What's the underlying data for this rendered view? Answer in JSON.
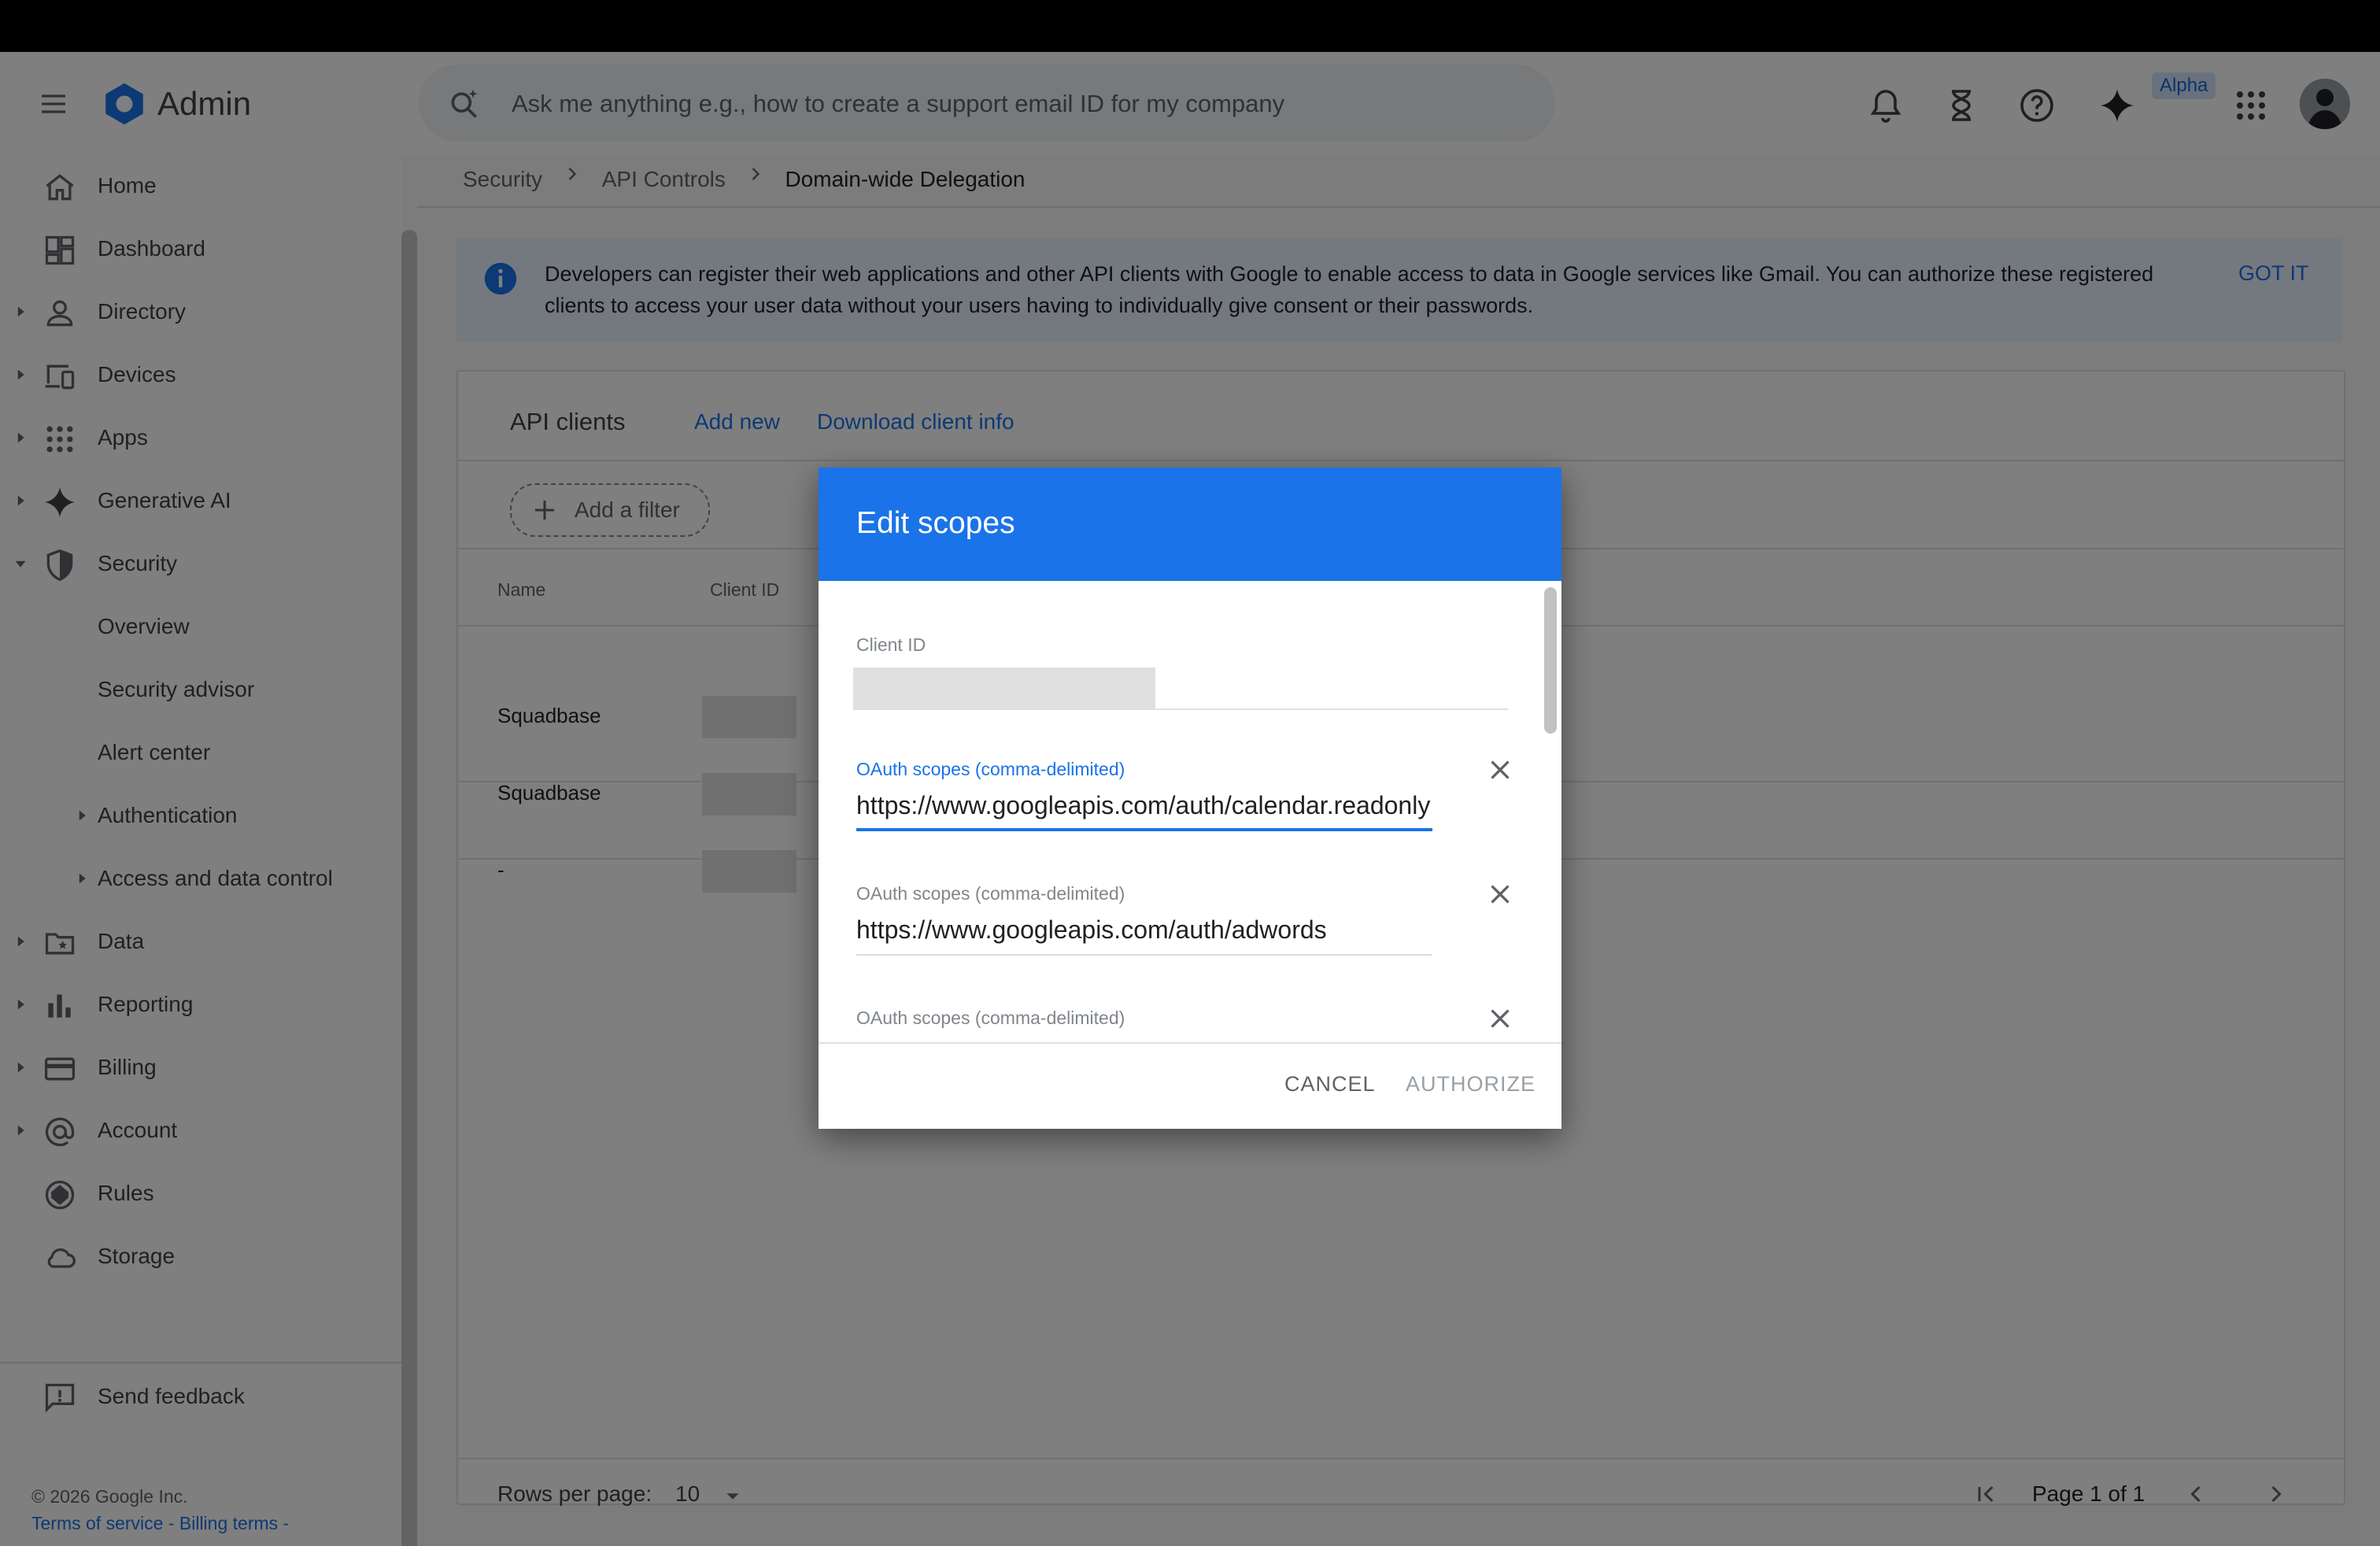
{
  "app": {
    "brand": "Admin",
    "search_placeholder": "Ask me anything e.g., how to create a support email ID for my company",
    "alpha_badge": "Alpha"
  },
  "sidebar": {
    "items": [
      {
        "label": "Home"
      },
      {
        "label": "Dashboard"
      },
      {
        "label": "Directory"
      },
      {
        "label": "Devices"
      },
      {
        "label": "Apps"
      },
      {
        "label": "Generative AI"
      },
      {
        "label": "Security"
      },
      {
        "label": "Overview"
      },
      {
        "label": "Security advisor"
      },
      {
        "label": "Alert center"
      },
      {
        "label": "Authentication"
      },
      {
        "label": "Access and data control"
      },
      {
        "label": "Data"
      },
      {
        "label": "Reporting"
      },
      {
        "label": "Billing"
      },
      {
        "label": "Account"
      },
      {
        "label": "Rules"
      },
      {
        "label": "Storage"
      }
    ],
    "feedback": "Send feedback",
    "copyright": "© 2026 Google Inc.",
    "terms": "Terms of service",
    "billing_terms": "Billing terms",
    "link_sep": " - "
  },
  "breadcrumb": {
    "items": [
      "Security",
      "API Controls"
    ],
    "current": "Domain-wide Delegation"
  },
  "banner": {
    "text": "Developers can register their web applications and other API clients with Google to enable access to data in Google services like Gmail. You can authorize these registered clients to access your user data without your users having to individually give consent or their passwords.",
    "action": "GOT IT"
  },
  "api_clients": {
    "title": "API clients",
    "add_new": "Add new",
    "download": "Download client info",
    "filter": "Add a filter",
    "columns": [
      "Name",
      "Client ID"
    ],
    "rows": [
      {
        "name": "Squadbase"
      },
      {
        "name": "Squadbase"
      },
      {
        "name": "-"
      }
    ],
    "rows_per_page_label": "Rows per page:",
    "rows_per_page": "10",
    "page": "Page 1 of 1"
  },
  "dialog": {
    "title": "Edit scopes",
    "client_id_label": "Client ID",
    "scope_label": "OAuth scopes (comma-delimited)",
    "scopes": [
      "https://www.googleapis.com/auth/calendar.readonly",
      "https://www.googleapis.com/auth/adwords",
      ""
    ],
    "cancel": "CANCEL",
    "authorize": "AUTHORIZE"
  },
  "colors": {
    "accent": "#1a73e8",
    "banner_bg": "#e8f0fe"
  }
}
